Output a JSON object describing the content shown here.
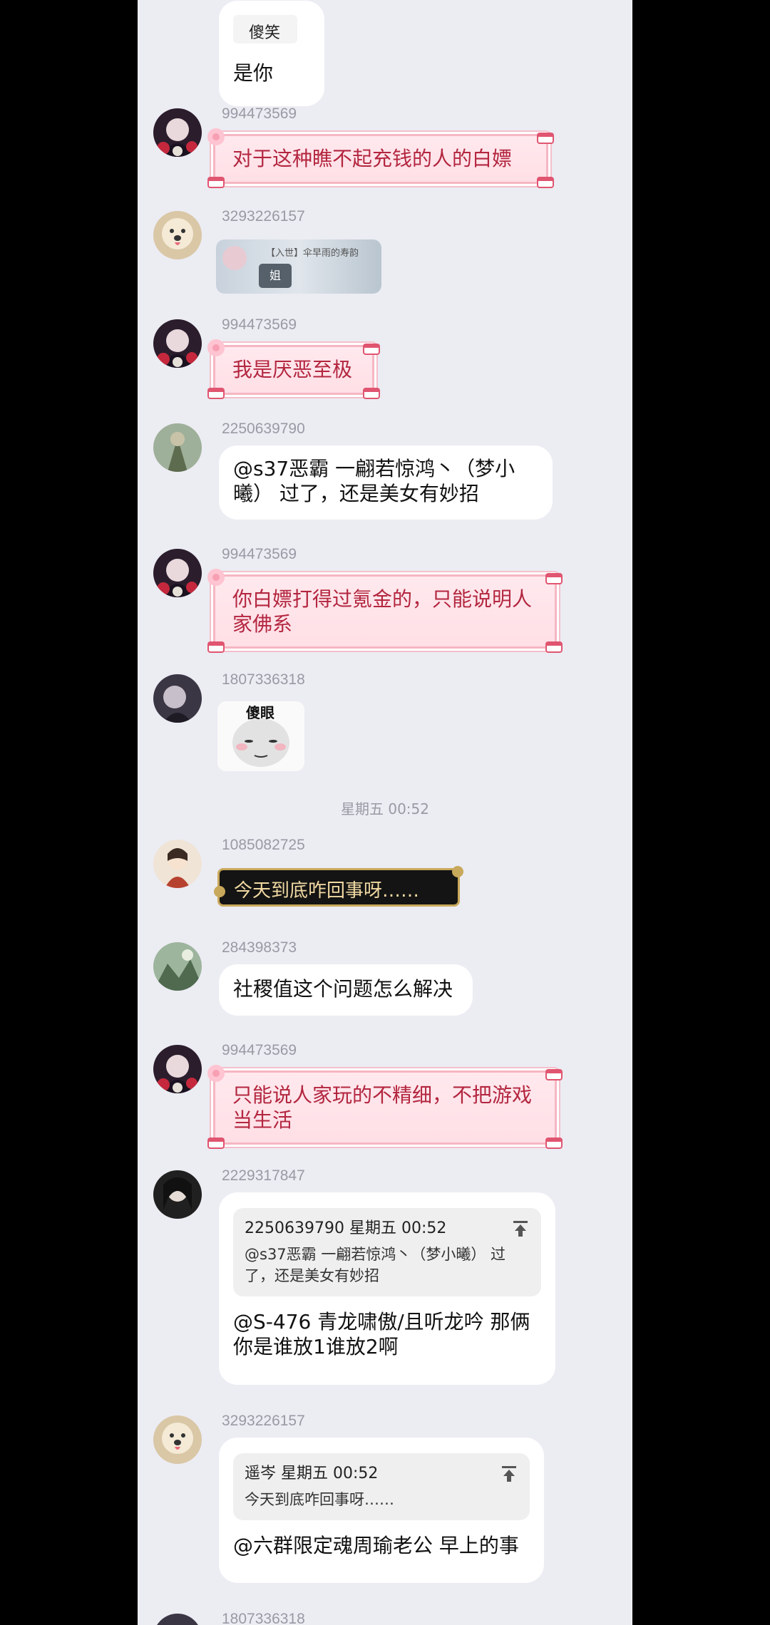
{
  "messages": [
    {
      "text": "是你",
      "sticker": "傻笑"
    },
    {
      "user": "994473569",
      "text": "对于这种瞧不起充钱的人的白嫖"
    },
    {
      "user": "3293226157",
      "sticker": {
        "line1": "【入世】伞早雨的寿韵",
        "badge": "姐"
      }
    },
    {
      "user": "994473569",
      "text": "我是厌恶至极"
    },
    {
      "user": "2250639790",
      "text": "@s37恶霸 一翩若惊鸿丶（梦小曦） 过了，还是美女有妙招"
    },
    {
      "user": "994473569",
      "text": "你白嫖打得过氪金的，只能说明人家佛系"
    },
    {
      "user": "1807336318",
      "sticker": "傻眼"
    },
    {
      "time": "星期五 00:52"
    },
    {
      "user": "1085082725",
      "text": "今天到底咋回事呀……"
    },
    {
      "user": "284398373",
      "text": "社稷值这个问题怎么解决"
    },
    {
      "user": "994473569",
      "text": "只能说人家玩的不精细，不把游戏当生活"
    },
    {
      "user": "2229317847",
      "quote": {
        "header": "2250639790 星期五 00:52",
        "body": "@s37恶霸 一翩若惊鸿丶（梦小曦） 过了，还是美女有妙招"
      },
      "text": "@S-476 青龙啸傲/且听龙吟 那俩你是谁放1谁放2啊"
    },
    {
      "user": "3293226157",
      "quote": {
        "header": "遥岑 星期五 00:52",
        "body": "今天到底咋回事呀……"
      },
      "text": "@六群限定魂周瑜老公 早上的事"
    },
    {
      "user": "1807336318"
    }
  ]
}
